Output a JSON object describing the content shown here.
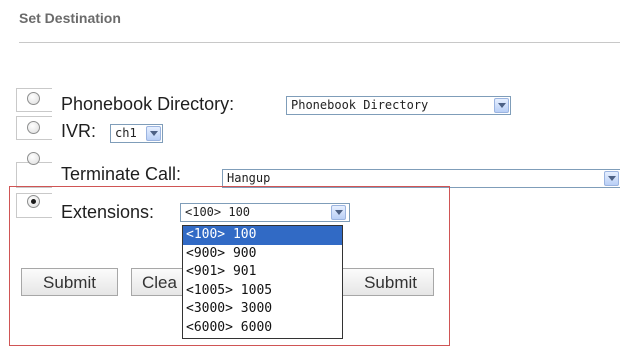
{
  "page": {
    "section_title": "Set Destination"
  },
  "destinations": [
    {
      "label": "Phonebook Directory:",
      "select_value": "Phonebook Directory",
      "checked": false
    },
    {
      "label": "IVR:",
      "select_value": "ch1",
      "checked": false
    },
    {
      "label": "Terminate Call:",
      "select_value": "Hangup",
      "checked": false
    },
    {
      "label": "Extensions:",
      "select_value": "<100> 100",
      "checked": true
    }
  ],
  "extensions_dropdown": {
    "options": [
      "<100> 100",
      "<900> 900",
      "<901> 901",
      "<1005> 1005",
      "<3000> 3000",
      "<6000> 6000"
    ],
    "selected_index": 0
  },
  "buttons": {
    "submit_label": "Submit",
    "clear_label": "Clea",
    "submit2_label": "Submit"
  },
  "colors": {
    "highlight_border": "#d05555",
    "selected_option_bg": "#316ac5",
    "title_text": "#6b6b6b"
  }
}
